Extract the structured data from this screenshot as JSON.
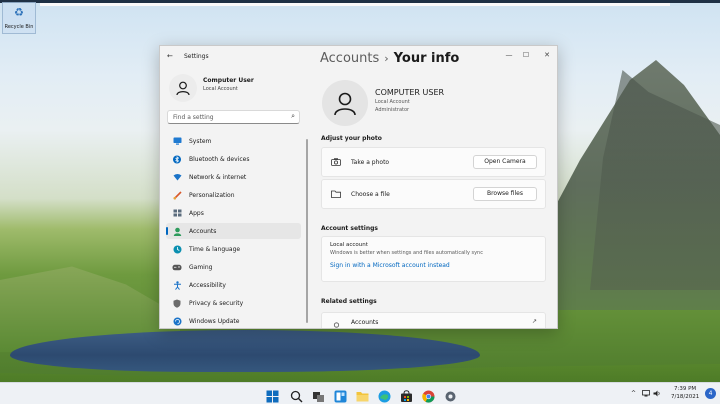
{
  "desktop": {
    "recycle_bin_label": "Recycle Bin"
  },
  "window": {
    "title": "Settings",
    "back_glyph": "←",
    "minimize_glyph": "—",
    "maximize_glyph": "☐",
    "close_glyph": "✕"
  },
  "sidebar": {
    "profile_name": "Computer User",
    "profile_type": "Local Account",
    "search_placeholder": "Find a setting",
    "items": [
      {
        "label": "System",
        "icon": "monitor-icon",
        "color": "#0067c0"
      },
      {
        "label": "Bluetooth & devices",
        "icon": "bluetooth-icon",
        "color": "#0067c0"
      },
      {
        "label": "Network & internet",
        "icon": "wifi-icon",
        "color": "#1a73c8"
      },
      {
        "label": "Personalization",
        "icon": "brush-icon",
        "color": "#d8572a"
      },
      {
        "label": "Apps",
        "icon": "apps-icon",
        "color": "#5a6b7c"
      },
      {
        "label": "Accounts",
        "icon": "person-icon",
        "color": "#2e9b5c",
        "active": true
      },
      {
        "label": "Time & language",
        "icon": "globe-clock-icon",
        "color": "#0a8fb0"
      },
      {
        "label": "Gaming",
        "icon": "controller-icon",
        "color": "#555555"
      },
      {
        "label": "Accessibility",
        "icon": "accessibility-icon",
        "color": "#1a73c8"
      },
      {
        "label": "Privacy & security",
        "icon": "shield-icon",
        "color": "#6b6b6b"
      },
      {
        "label": "Windows Update",
        "icon": "update-icon",
        "color": "#1a73c8"
      }
    ]
  },
  "header": {
    "parent": "Accounts",
    "separator": "›",
    "current": "Your info"
  },
  "user": {
    "name": "COMPUTER USER",
    "account_type": "Local Account",
    "role": "Administrator"
  },
  "photo_section": {
    "heading": "Adjust your photo",
    "take_photo_label": "Take a photo",
    "open_camera_button": "Open Camera",
    "choose_file_label": "Choose a file",
    "browse_files_button": "Browse files"
  },
  "account_settings": {
    "heading": "Account settings",
    "title": "Local account",
    "subtitle": "Windows is better when settings and files automatically sync",
    "link": "Sign in with a Microsoft account instead"
  },
  "related": {
    "heading": "Related settings",
    "accounts_label": "Accounts",
    "external_glyph": "↗"
  },
  "taskbar": {
    "tray_chevron": "^",
    "time": "7:39 PM",
    "date": "7/18/2021",
    "notification_count": "4",
    "icons": [
      "windows-start-icon",
      "search-icon",
      "task-view-icon",
      "widgets-icon",
      "file-explorer-icon",
      "edge-icon",
      "store-icon",
      "chrome-icon",
      "settings-icon"
    ]
  },
  "colors": {
    "accent": "#0067c0",
    "window_bg": "#f3f3f3",
    "card_bg": "#fbfbfb"
  }
}
